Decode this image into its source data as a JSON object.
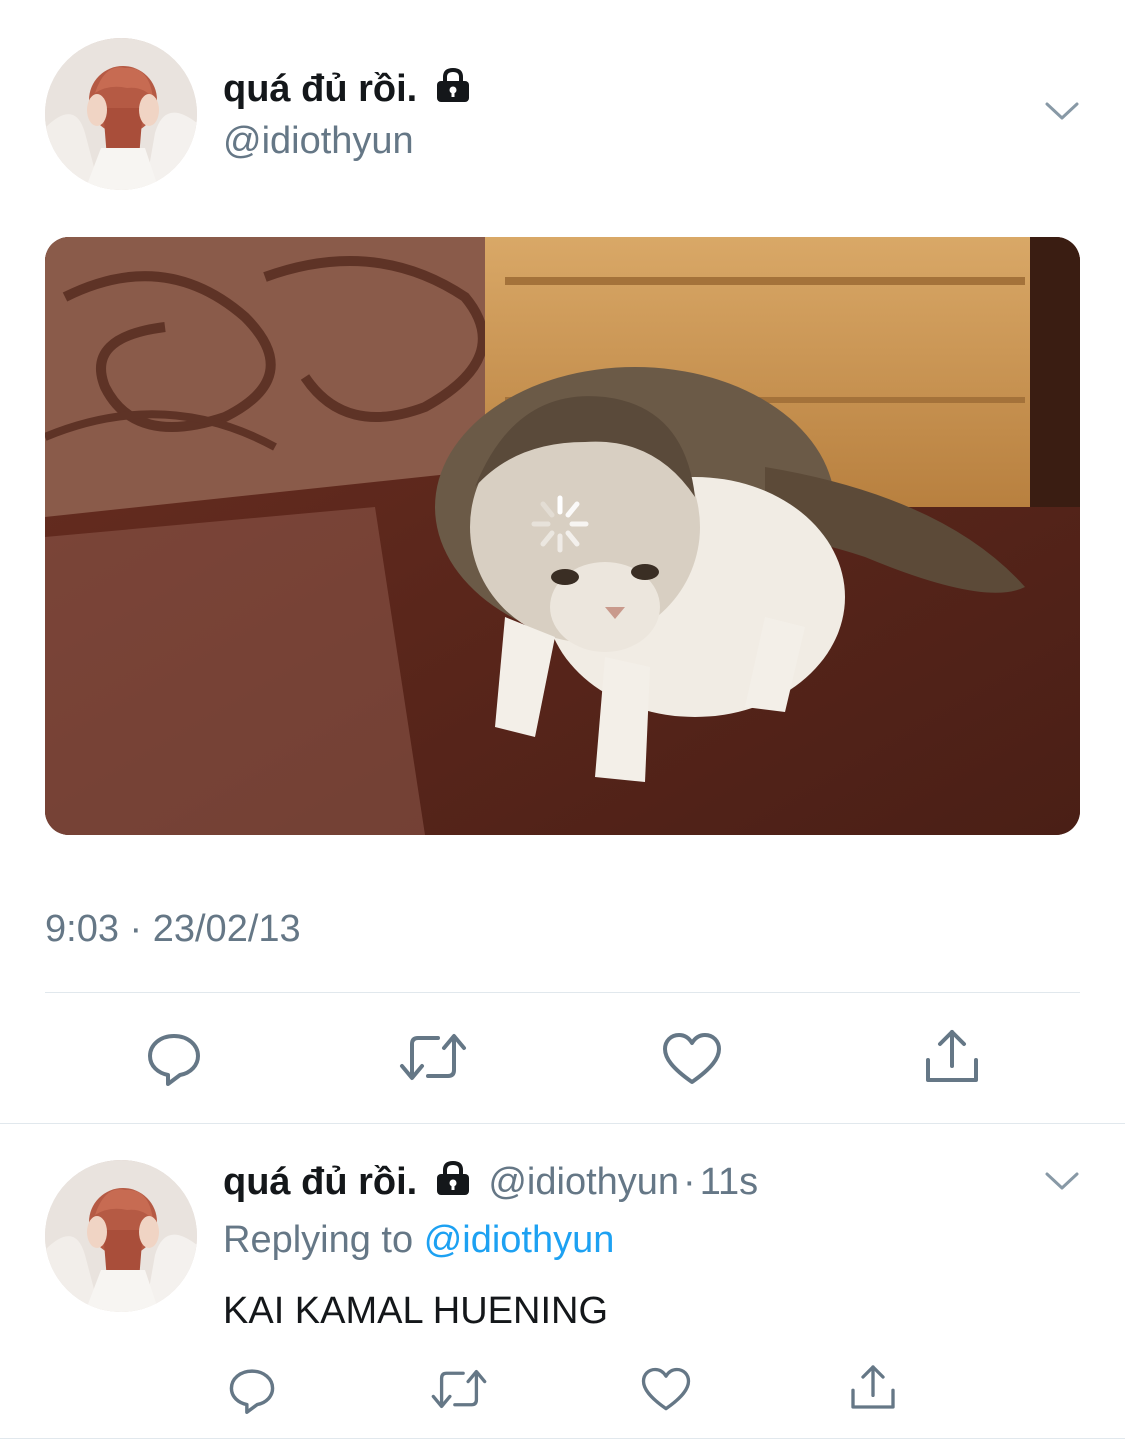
{
  "tweet": {
    "display_name": "quá đủ rồi.",
    "handle": "@idiothyun",
    "timestamp": "9:03 · 23/02/13",
    "icons": {
      "lock": "lock-icon",
      "menu": "chevron-down-icon",
      "reply": "reply-icon",
      "retweet": "retweet-icon",
      "like": "like-icon",
      "share": "share-icon"
    }
  },
  "reply": {
    "display_name": "quá đủ rồi.",
    "handle": "@idiothyun",
    "separator": "·",
    "age": "11s",
    "replying_prefix": "Replying to",
    "replying_handle": "@idiothyun",
    "text": "KAI KAMAL HUENING"
  },
  "colors": {
    "text": "#14171a",
    "muted": "#657786",
    "link": "#1da1f2",
    "divider": "#e1e8ed"
  }
}
